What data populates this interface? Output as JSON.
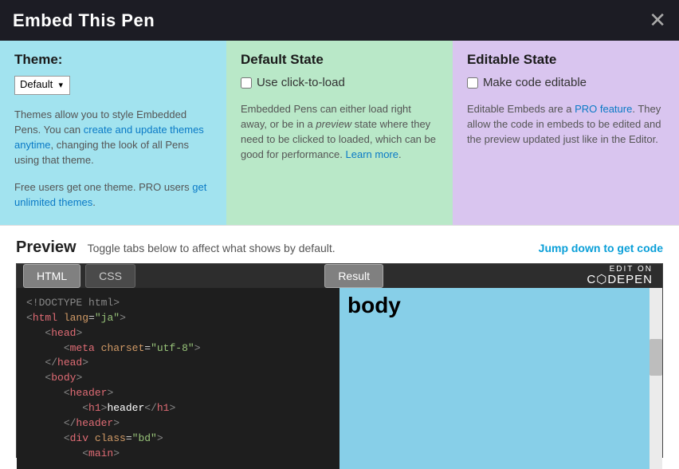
{
  "header": {
    "title": "Embed This Pen"
  },
  "theme": {
    "heading": "Theme:",
    "selected": "Default",
    "desc1a": "Themes allow you to style Embedded Pens. You can ",
    "link1": "create and update themes anytime",
    "desc1b": ", changing the look of all Pens using that theme.",
    "desc2a": "Free users get one theme. PRO users ",
    "link2": "get unlimited themes",
    "desc2b": "."
  },
  "defaultState": {
    "heading": "Default State",
    "checkbox": "Use click-to-load",
    "desc_a": "Embedded Pens can either load right away, or be in a ",
    "desc_em": "preview",
    "desc_b": " state where they need to be clicked to loaded, which can be good for performance. ",
    "link": "Learn more",
    "desc_c": "."
  },
  "editableState": {
    "heading": "Editable State",
    "checkbox": "Make code editable",
    "desc_a": "Editable Embeds are a ",
    "link": "PRO feature",
    "desc_b": ". They allow the code in embeds to be edited and the preview updated just like in the Editor."
  },
  "preview": {
    "title": "Preview",
    "subtitle": "Toggle tabs below to affect what shows by default.",
    "jump": "Jump down to get code"
  },
  "tabs": {
    "html": "HTML",
    "css": "CSS",
    "result": "Result"
  },
  "logo": {
    "top": "EDIT ON",
    "main": "C⬡DEPEN"
  },
  "result": {
    "body": "body"
  },
  "code": {
    "l1a": "<!DOCTYPE html>",
    "l2a": "<",
    "l2b": "html",
    "l2c": " lang",
    "l2d": "=",
    "l2e": "\"ja\"",
    "l2f": ">",
    "l3a": "<",
    "l3b": "head",
    "l3c": ">",
    "l4a": "<",
    "l4b": "meta",
    "l4c": " charset",
    "l4d": "=",
    "l4e": "\"utf-8\"",
    "l4f": ">",
    "l5a": "</",
    "l5b": "head",
    "l5c": ">",
    "l6a": "<",
    "l6b": "body",
    "l6c": ">",
    "l7a": "<",
    "l7b": "header",
    "l7c": ">",
    "l8a": "<",
    "l8b": "h1",
    "l8c": ">",
    "l8d": "header",
    "l8e": "</",
    "l8f": "h1",
    "l8g": ">",
    "l9a": "</",
    "l9b": "header",
    "l9c": ">",
    "l10a": "<",
    "l10b": "div",
    "l10c": " class",
    "l10d": "=",
    "l10e": "\"bd\"",
    "l10f": ">",
    "l11a": "<",
    "l11b": "main",
    "l11c": ">"
  }
}
